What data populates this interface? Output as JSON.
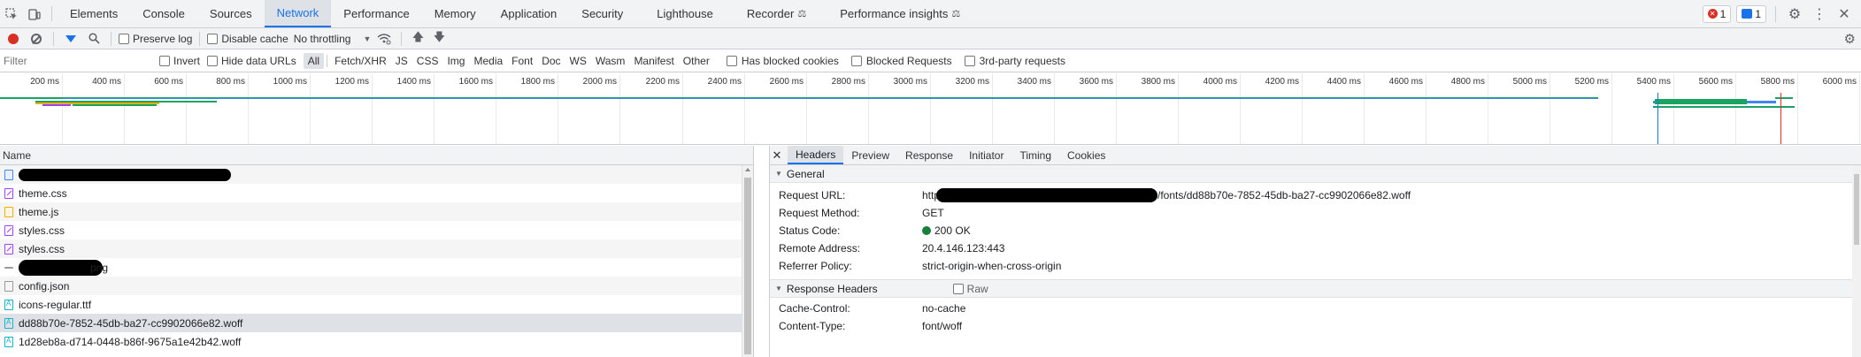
{
  "tabbar": {
    "tabs": [
      {
        "label": "Elements"
      },
      {
        "label": "Console"
      },
      {
        "label": "Sources"
      },
      {
        "label": "Network",
        "active": true
      },
      {
        "label": "Performance"
      },
      {
        "label": "Memory"
      },
      {
        "label": "Application"
      },
      {
        "label": "Security"
      },
      {
        "label": "Lighthouse"
      },
      {
        "label": "Recorder",
        "flask": true
      },
      {
        "label": "Performance insights",
        "flask": true
      }
    ],
    "error_count": "1",
    "message_count": "1"
  },
  "toolbar": {
    "preserve_log_label": "Preserve log",
    "disable_cache_label": "Disable cache",
    "throttling_value": "No throttling"
  },
  "filterbar": {
    "filter_placeholder": "Filter",
    "invert_label": "Invert",
    "hide_data_urls_label": "Hide data URLs",
    "types": [
      "All",
      "Fetch/XHR",
      "JS",
      "CSS",
      "Img",
      "Media",
      "Font",
      "Doc",
      "WS",
      "Wasm",
      "Manifest",
      "Other"
    ],
    "has_blocked_cookies_label": "Has blocked cookies",
    "blocked_requests_label": "Blocked Requests",
    "third_party_label": "3rd-party requests"
  },
  "overview": {
    "ticks": [
      "200 ms",
      "400 ms",
      "600 ms",
      "800 ms",
      "1000 ms",
      "1200 ms",
      "1400 ms",
      "1600 ms",
      "1800 ms",
      "2000 ms",
      "2200 ms",
      "2400 ms",
      "2600 ms",
      "2800 ms",
      "3000 ms",
      "3200 ms",
      "3400 ms",
      "3600 ms",
      "3800 ms",
      "4000 ms",
      "4200 ms",
      "4400 ms",
      "4600 ms",
      "4800 ms",
      "5000 ms",
      "5200 ms",
      "5400 ms",
      "5600 ms",
      "5800 ms",
      "6000 ms"
    ]
  },
  "requests": {
    "column_name": "Name",
    "rows": [
      {
        "name": "",
        "type": "doc",
        "redacted": true
      },
      {
        "name": "theme.css",
        "type": "css"
      },
      {
        "name": "theme.js",
        "type": "js"
      },
      {
        "name": "styles.css",
        "type": "css"
      },
      {
        "name": "styles.css",
        "type": "css"
      },
      {
        "name": "png",
        "type": "img",
        "redacted": true
      },
      {
        "name": "config.json",
        "type": "json"
      },
      {
        "name": "icons-regular.ttf",
        "type": "font"
      },
      {
        "name": "dd88b70e-7852-45db-ba27-cc9902066e82.woff",
        "type": "font",
        "selected": true
      },
      {
        "name": "1d28eb8a-d714-0448-b86f-9675a1e42b42.woff",
        "type": "font"
      }
    ]
  },
  "details": {
    "tabs": [
      "Headers",
      "Preview",
      "Response",
      "Initiator",
      "Timing",
      "Cookies"
    ],
    "general": {
      "title": "General",
      "rows": [
        {
          "key": "Request URL:",
          "value": "/fonts/dd88b70e-7852-45db-ba27-cc9902066e82.woff",
          "prefix": "http"
        },
        {
          "key": "Request Method:",
          "value": "GET"
        },
        {
          "key": "Status Code:",
          "value": "200 OK"
        },
        {
          "key": "Remote Address:",
          "value": "20.4.146.123:443"
        },
        {
          "key": "Referrer Policy:",
          "value": "strict-origin-when-cross-origin"
        }
      ]
    },
    "response_headers": {
      "title": "Response Headers",
      "raw_label": "Raw",
      "rows": [
        {
          "key": "Cache-Control:",
          "value": "no-cache"
        },
        {
          "key": "Content-Type:",
          "value": "font/woff"
        }
      ]
    }
  }
}
